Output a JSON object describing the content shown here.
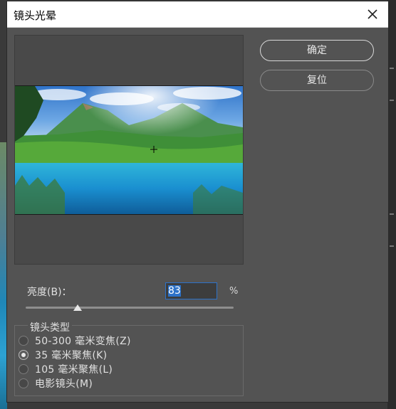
{
  "dialog": {
    "title": "镜头光晕",
    "buttons": {
      "ok": "确定",
      "reset": "复位"
    }
  },
  "brightness": {
    "label": "亮度(B)：",
    "value": "83",
    "unit": "%",
    "slider_fraction": 0.25
  },
  "lens_type": {
    "group_label": "镜头类型",
    "options": [
      {
        "label": "50-300 毫米变焦(Z)",
        "selected": false
      },
      {
        "label": "35 毫米聚焦(K)",
        "selected": true
      },
      {
        "label": "105 毫米聚焦(L)",
        "selected": false
      },
      {
        "label": "电影镜头(M)",
        "selected": false
      }
    ]
  },
  "colors": {
    "dialog_bg": "#535353",
    "accent": "#2d72c8"
  },
  "icons": {
    "close": "close-icon",
    "flare_center": "crosshair-icon"
  }
}
